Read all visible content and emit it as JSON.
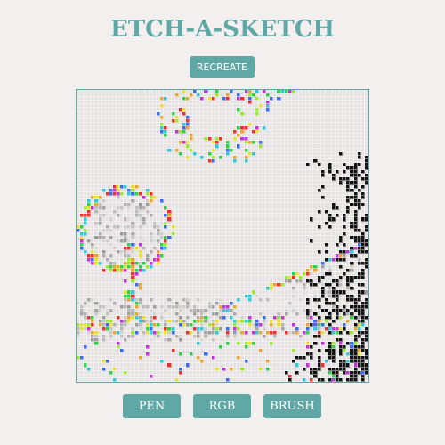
{
  "app": {
    "title": "ETCH-A-SKETCH",
    "accent_color": "#5fa8a5"
  },
  "controls": {
    "recreate_label": "RECREATE",
    "modes": [
      {
        "label": "PEN"
      },
      {
        "label": "RGB"
      },
      {
        "label": "BRUSH"
      }
    ]
  },
  "grid": {
    "cells_per_side": 80,
    "background_color": "#e6e2e2",
    "palette": [
      "#e83232",
      "#3a6be8",
      "#2fcf4a",
      "#c431d6",
      "#e8a531",
      "#32c7d6",
      "#9be832",
      "#e8e031",
      "#111111"
    ]
  }
}
